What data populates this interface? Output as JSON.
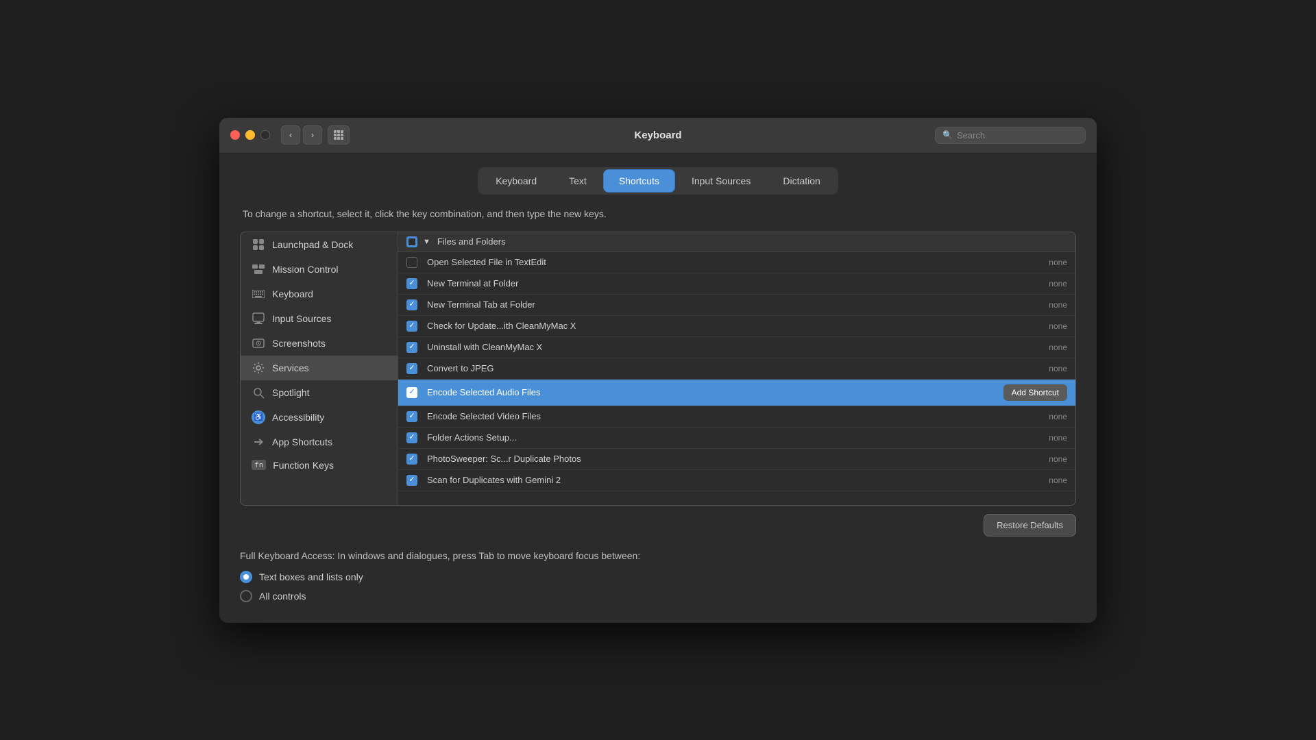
{
  "window": {
    "title": "Keyboard"
  },
  "titlebar": {
    "search_placeholder": "Search"
  },
  "tabs": [
    {
      "id": "keyboard",
      "label": "Keyboard",
      "active": false
    },
    {
      "id": "text",
      "label": "Text",
      "active": false
    },
    {
      "id": "shortcuts",
      "label": "Shortcuts",
      "active": true
    },
    {
      "id": "input-sources",
      "label": "Input Sources",
      "active": false
    },
    {
      "id": "dictation",
      "label": "Dictation",
      "active": false
    }
  ],
  "instruction": "To change a shortcut, select it, click the key combination, and then type the new keys.",
  "sidebar": {
    "items": [
      {
        "id": "launchpad",
        "label": "Launchpad & Dock",
        "icon": "⌨",
        "active": false
      },
      {
        "id": "mission-control",
        "label": "Mission Control",
        "icon": "🟦",
        "active": false
      },
      {
        "id": "keyboard",
        "label": "Keyboard",
        "icon": "⌨",
        "active": false
      },
      {
        "id": "input-sources",
        "label": "Input Sources",
        "icon": "🟦",
        "active": false
      },
      {
        "id": "screenshots",
        "label": "Screenshots",
        "icon": "📷",
        "active": false
      },
      {
        "id": "services",
        "label": "Services",
        "icon": "⚙",
        "active": true
      },
      {
        "id": "spotlight",
        "label": "Spotlight",
        "icon": "🔦",
        "active": false
      },
      {
        "id": "accessibility",
        "label": "Accessibility",
        "icon": "♿",
        "active": false
      },
      {
        "id": "app-shortcuts",
        "label": "App Shortcuts",
        "icon": "✂",
        "active": false
      },
      {
        "id": "function-keys",
        "label": "Function Keys",
        "icon": "fn",
        "active": false
      }
    ]
  },
  "section": {
    "title": "Files and Folders",
    "collapse_icon": "▼"
  },
  "shortcuts": [
    {
      "id": "open-textedit",
      "label": "Open Selected File in TextEdit",
      "shortcut": "none",
      "checked": false,
      "selected": false
    },
    {
      "id": "new-terminal-folder",
      "label": "New Terminal at Folder",
      "shortcut": "none",
      "checked": true,
      "selected": false
    },
    {
      "id": "new-terminal-tab",
      "label": "New Terminal Tab at Folder",
      "shortcut": "none",
      "checked": true,
      "selected": false
    },
    {
      "id": "check-update-cleanmymac",
      "label": "Check for Update...ith CleanMyMac X",
      "shortcut": "none",
      "checked": true,
      "selected": false
    },
    {
      "id": "uninstall-cleanmymac",
      "label": "Uninstall with CleanMyMac X",
      "shortcut": "none",
      "checked": true,
      "selected": false
    },
    {
      "id": "convert-jpeg",
      "label": "Convert to JPEG",
      "shortcut": "none",
      "checked": true,
      "selected": false
    },
    {
      "id": "encode-audio",
      "label": "Encode Selected Audio Files",
      "shortcut": "Add Shortcut",
      "checked": true,
      "selected": true
    },
    {
      "id": "encode-video",
      "label": "Encode Selected Video Files",
      "shortcut": "none",
      "checked": true,
      "selected": false
    },
    {
      "id": "folder-actions",
      "label": "Folder Actions Setup...",
      "shortcut": "none",
      "checked": true,
      "selected": false
    },
    {
      "id": "photosweeper",
      "label": "PhotoSweeper: Sc...r Duplicate Photos",
      "shortcut": "none",
      "checked": true,
      "selected": false
    },
    {
      "id": "scan-gemini",
      "label": "Scan for Duplicates with Gemini 2",
      "shortcut": "none",
      "checked": true,
      "selected": false
    }
  ],
  "buttons": {
    "restore_defaults": "Restore Defaults",
    "add_shortcut": "Add Shortcut"
  },
  "keyboard_access": {
    "title": "Full Keyboard Access: In windows and dialogues, press Tab to move keyboard focus between:",
    "options": [
      {
        "id": "text-boxes",
        "label": "Text boxes and lists only",
        "selected": true
      },
      {
        "id": "all-controls",
        "label": "All controls",
        "selected": false
      }
    ]
  }
}
